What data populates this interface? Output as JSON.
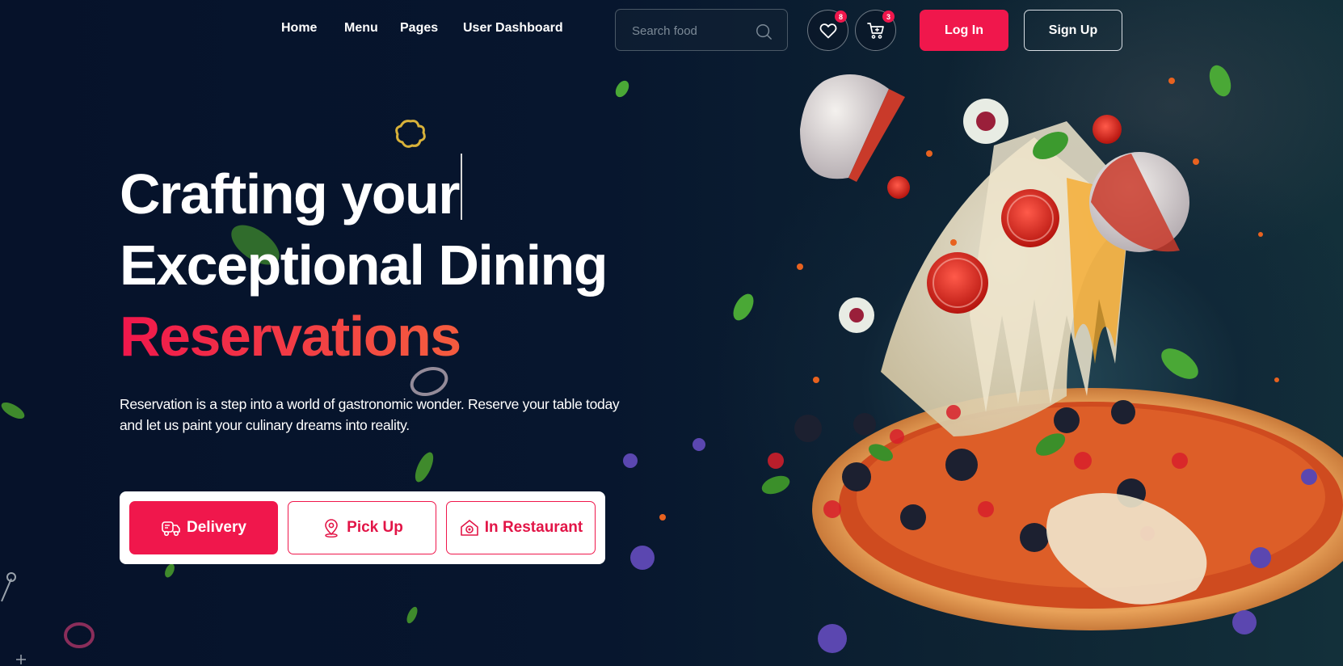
{
  "nav": {
    "links": [
      "Home",
      "Menu",
      "Pages",
      "User Dashboard"
    ]
  },
  "search": {
    "placeholder": "Search food",
    "icon": "search-icon"
  },
  "wishlist": {
    "icon": "heart-icon",
    "count": "8"
  },
  "cart": {
    "icon": "cart-icon",
    "count": "3"
  },
  "auth": {
    "login_label": "Log In",
    "signup_label": "Sign Up"
  },
  "hero": {
    "title_line1": "Crafting your",
    "title_line2": "Exceptional Dining",
    "title_accent": "Reservations",
    "description": "Reservation is a step into a world of gastronomic wonder. Reserve your table today and let us paint your culinary dreams into reality."
  },
  "order_options": [
    {
      "label": "Delivery",
      "icon": "delivery-truck-icon",
      "selected": true
    },
    {
      "label": "Pick Up",
      "icon": "location-pin-icon",
      "selected": false
    },
    {
      "label": "In Restaurant",
      "icon": "restaurant-icon",
      "selected": false
    }
  ],
  "colors": {
    "accent": "#f0174c",
    "background": "#07142a",
    "accent_gradient_end": "#f36a3c"
  }
}
